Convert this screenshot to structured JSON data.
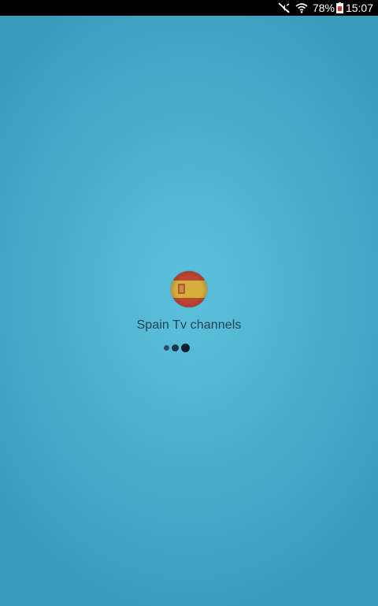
{
  "status_bar": {
    "icons": [
      "mute-vibrate-icon",
      "wifi-icon",
      "battery-icon"
    ],
    "battery_percent": "78%",
    "time": "15:07"
  },
  "splash": {
    "logo_icon": "spain-flag-icon",
    "app_name": "Spain Tv channels",
    "loader_icon": "loading-dots-icon"
  },
  "colors": {
    "background_center": "#5ec1dc",
    "background_edge": "#3a9cbb",
    "flag_red": "#c8412f",
    "flag_yellow": "#e2b83a",
    "app_name_text": "#1f4356"
  }
}
